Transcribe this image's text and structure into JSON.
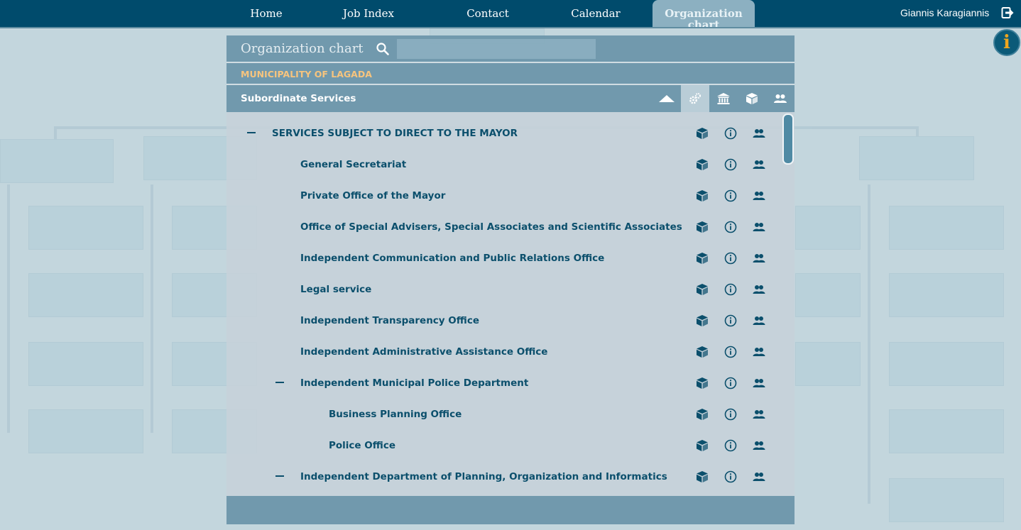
{
  "nav": {
    "items": [
      {
        "label": "Home"
      },
      {
        "label": "Job Index"
      },
      {
        "label": "Contact"
      },
      {
        "label": "Calendar"
      },
      {
        "label": "Organization chart",
        "active": true
      }
    ],
    "user_name": "Giannis Karagiannis",
    "logout_icon": "logout-icon",
    "info_button": "i"
  },
  "panel": {
    "title": "Organization chart",
    "search_placeholder": "",
    "org_name": "MUNICIPALITY OF LAGADA",
    "section_title": "Subordinate Services",
    "tools": [
      "services-icon",
      "institution-icon",
      "cube-icon",
      "people-icon"
    ]
  },
  "tree": {
    "row_icons": [
      "cube-icon",
      "info-circle-icon",
      "people-icon"
    ],
    "items": [
      {
        "label": "SERVICES SUBJECT TO DIRECT TO THE MAYOR",
        "level": 0,
        "expanded": true
      },
      {
        "label": "General Secretariat",
        "level": 1,
        "expanded": false
      },
      {
        "label": "Private Office of the Mayor",
        "level": 1,
        "expanded": false
      },
      {
        "label": "Office of Special Advisers, Special Associates and Scientific Associates",
        "level": 1,
        "expanded": false
      },
      {
        "label": "Independent Communication and Public Relations Office",
        "level": 1,
        "expanded": false
      },
      {
        "label": "Legal service",
        "level": 1,
        "expanded": false
      },
      {
        "label": "Independent Transparency Office",
        "level": 1,
        "expanded": false
      },
      {
        "label": "Independent Administrative Assistance Office",
        "level": 1,
        "expanded": false
      },
      {
        "label": "Independent Municipal Police Department",
        "level": 1,
        "expanded": true
      },
      {
        "label": "Business Planning Office",
        "level": 2,
        "expanded": false
      },
      {
        "label": "Police Office",
        "level": 2,
        "expanded": false
      },
      {
        "label": "Independent Department of Planning, Organization and Informatics",
        "level": 1,
        "expanded": true
      }
    ]
  },
  "colors": {
    "nav_bg": "#004b6c",
    "accent_text": "#0b4f6c",
    "org_name": "#f6c47e",
    "info_bubble": "#f0a61c"
  }
}
